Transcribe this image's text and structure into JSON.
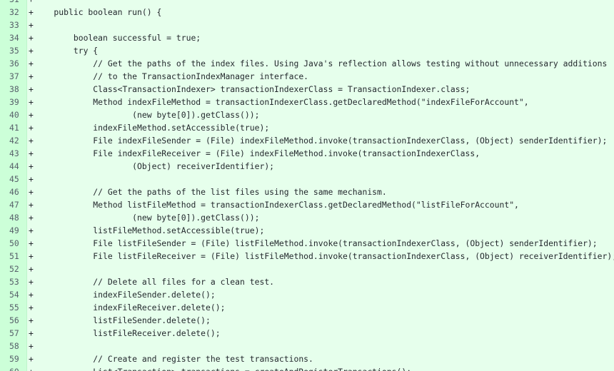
{
  "diff": {
    "marker": "+",
    "lines": [
      {
        "num": "31",
        "code": ""
      },
      {
        "num": "32",
        "code": "    public boolean run() {"
      },
      {
        "num": "33",
        "code": ""
      },
      {
        "num": "34",
        "code": "        boolean successful = true;"
      },
      {
        "num": "35",
        "code": "        try {"
      },
      {
        "num": "36",
        "code": "            // Get the paths of the index files. Using Java's reflection allows testing without unnecessary additions"
      },
      {
        "num": "37",
        "code": "            // to the TransactionIndexManager interface."
      },
      {
        "num": "38",
        "code": "            Class<TransactionIndexer> transactionIndexerClass = TransactionIndexer.class;"
      },
      {
        "num": "39",
        "code": "            Method indexFileMethod = transactionIndexerClass.getDeclaredMethod(\"indexFileForAccount\","
      },
      {
        "num": "40",
        "code": "                    (new byte[0]).getClass());"
      },
      {
        "num": "41",
        "code": "            indexFileMethod.setAccessible(true);"
      },
      {
        "num": "42",
        "code": "            File indexFileSender = (File) indexFileMethod.invoke(transactionIndexerClass, (Object) senderIdentifier);"
      },
      {
        "num": "43",
        "code": "            File indexFileReceiver = (File) indexFileMethod.invoke(transactionIndexerClass,"
      },
      {
        "num": "44",
        "code": "                    (Object) receiverIdentifier);"
      },
      {
        "num": "45",
        "code": ""
      },
      {
        "num": "46",
        "code": "            // Get the paths of the list files using the same mechanism."
      },
      {
        "num": "47",
        "code": "            Method listFileMethod = transactionIndexerClass.getDeclaredMethod(\"listFileForAccount\","
      },
      {
        "num": "48",
        "code": "                    (new byte[0]).getClass());"
      },
      {
        "num": "49",
        "code": "            listFileMethod.setAccessible(true);"
      },
      {
        "num": "50",
        "code": "            File listFileSender = (File) listFileMethod.invoke(transactionIndexerClass, (Object) senderIdentifier);"
      },
      {
        "num": "51",
        "code": "            File listFileReceiver = (File) listFileMethod.invoke(transactionIndexerClass, (Object) receiverIdentifier);"
      },
      {
        "num": "52",
        "code": ""
      },
      {
        "num": "53",
        "code": "            // Delete all files for a clean test."
      },
      {
        "num": "54",
        "code": "            indexFileSender.delete();"
      },
      {
        "num": "55",
        "code": "            indexFileReceiver.delete();"
      },
      {
        "num": "56",
        "code": "            listFileSender.delete();"
      },
      {
        "num": "57",
        "code": "            listFileReceiver.delete();"
      },
      {
        "num": "58",
        "code": ""
      },
      {
        "num": "59",
        "code": "            // Create and register the test transactions."
      },
      {
        "num": "60",
        "code": "            List<Transaction> transactions = createAndRegisterTransactions();"
      }
    ]
  }
}
